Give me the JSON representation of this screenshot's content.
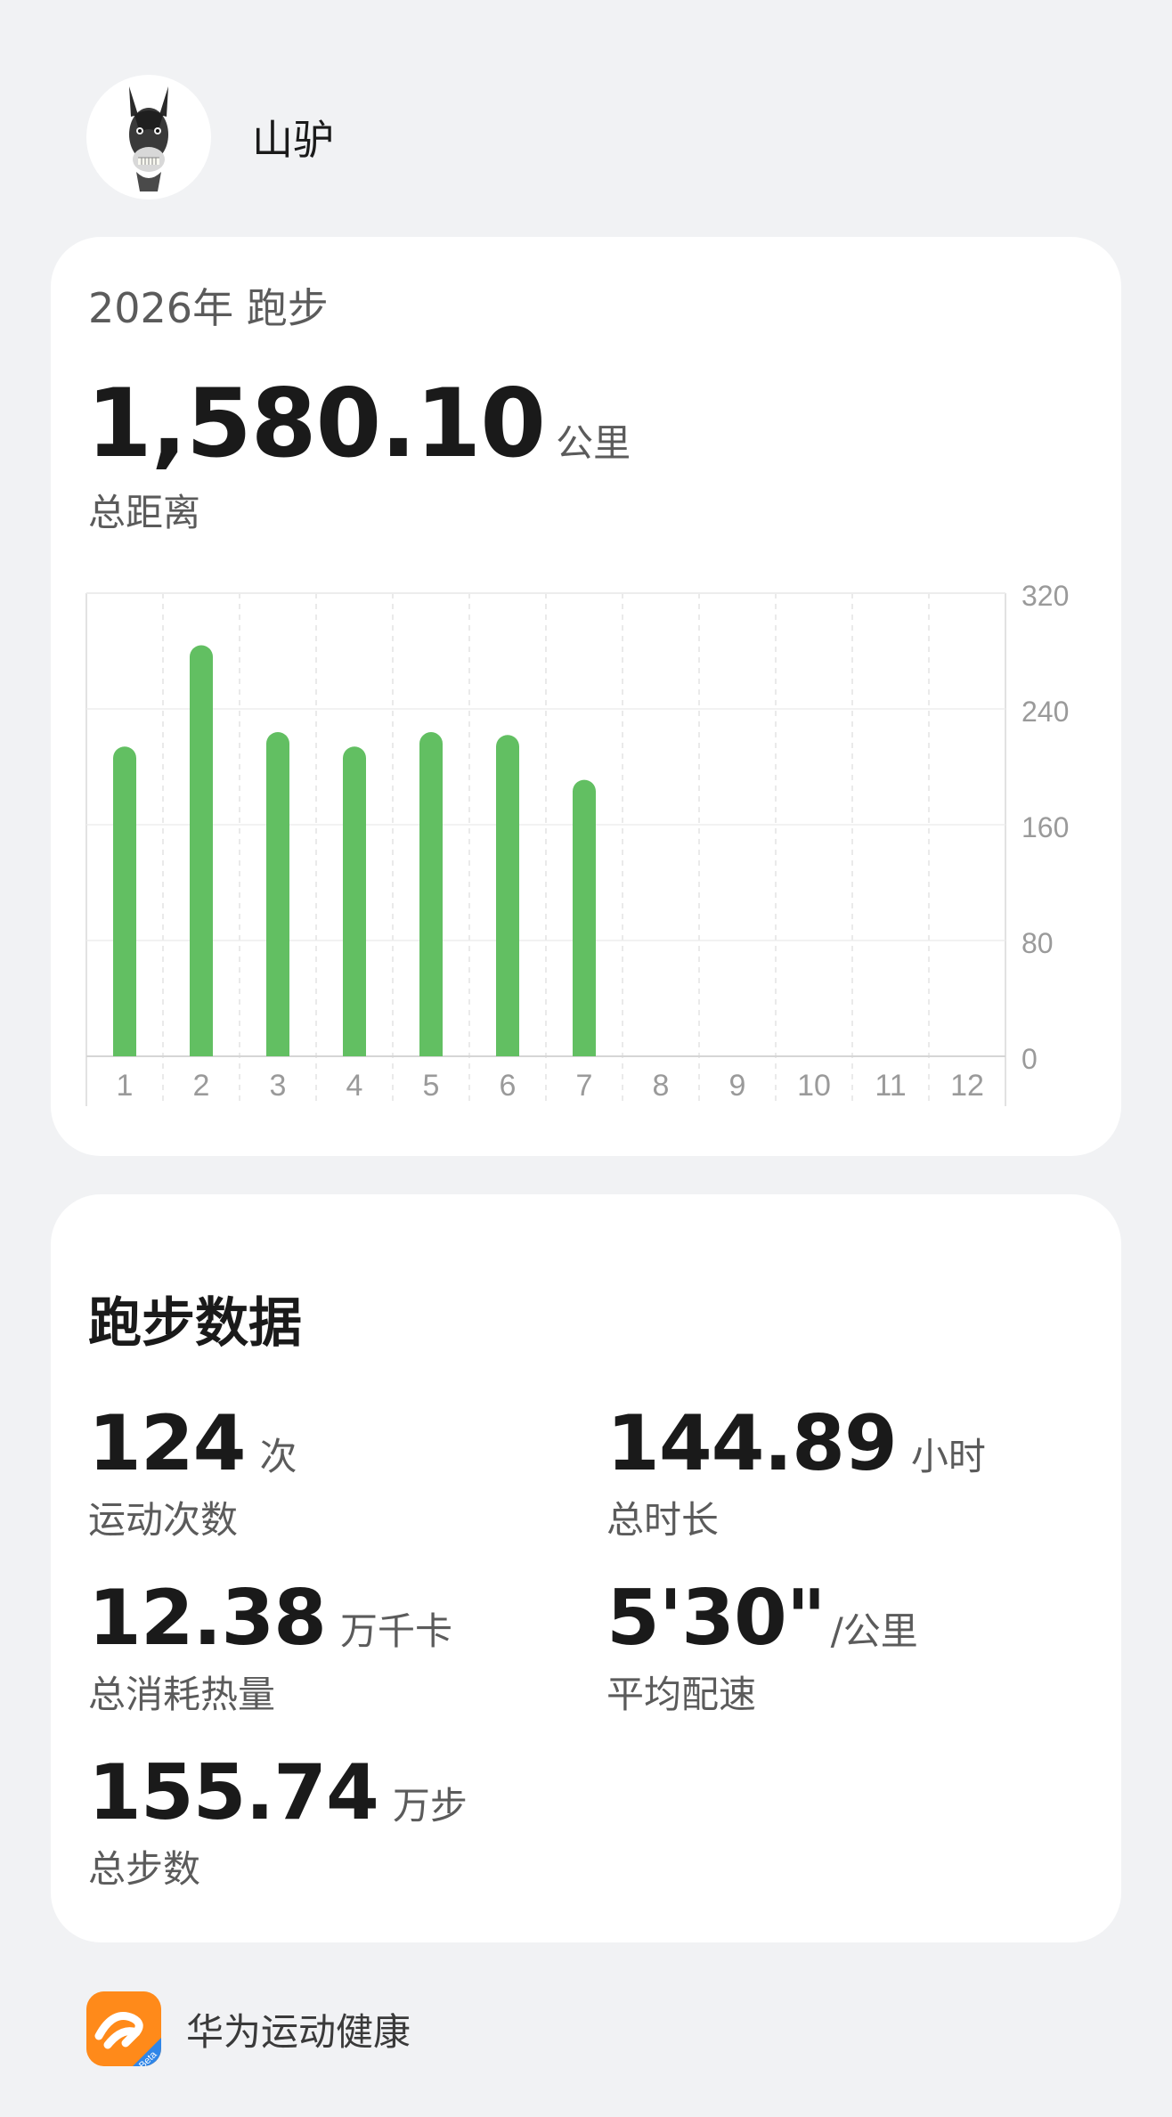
{
  "user": {
    "name": "山驴",
    "avatar_icon": "donkey-avatar-icon"
  },
  "summary": {
    "title": "2026年 跑步",
    "total_distance": "1,580.10",
    "total_unit": "公里",
    "total_label": "总距离"
  },
  "chart_data": {
    "type": "bar",
    "categories": [
      "1",
      "2",
      "3",
      "4",
      "5",
      "6",
      "7",
      "8",
      "9",
      "10",
      "11",
      "12"
    ],
    "values": [
      214,
      284,
      224,
      214,
      224,
      222,
      191,
      null,
      null,
      null,
      null,
      null
    ],
    "ylim": [
      0,
      320
    ],
    "y_ticks": [
      "0",
      "80",
      "160",
      "240",
      "320"
    ],
    "y_axis_side": "right",
    "grid": true,
    "bar_color": "#62bf62"
  },
  "stats": {
    "title": "跑步数据",
    "items": [
      {
        "value": "124",
        "unit": "次",
        "label": "运动次数"
      },
      {
        "value": "144.89",
        "unit": "小时",
        "label": "总时长"
      },
      {
        "value": "12.38",
        "unit": "万千卡",
        "label": "总消耗热量"
      },
      {
        "value": "5'30\"",
        "unit": "/公里",
        "label": "平均配速"
      },
      {
        "value": "155.74",
        "unit": "万步",
        "label": "总步数"
      }
    ]
  },
  "footer": {
    "app_name": "华为运动健康",
    "app_icon": "huawei-health-beta-icon",
    "badge": "Beta",
    "accent_color": "#ff8f1f"
  }
}
